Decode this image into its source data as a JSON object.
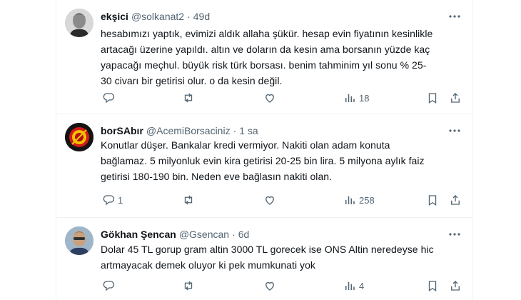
{
  "tweets": [
    {
      "name": "ekşici",
      "handle": "@solkanat2",
      "time": "49d",
      "lines": [
        "hesabımızı yaptık, evimizi aldık allaha şükür. hesap evin fiyatının kesinlikle",
        "artacağı üzerine yapıldı. altın ve doların da kesin ama borsanın yüzde kaç",
        "yapacağı meçhul. büyük risk türk borsası. benim tahminim yıl sonu % 25-",
        "30 civarı bir getirisi olur. o da kesin değil."
      ],
      "replies": "",
      "views": "18"
    },
    {
      "name": "borSAbır",
      "handle": "@AcemiBorsaciniz",
      "time": "1 sa",
      "lines": [
        "Konutlar düşer. Bankalar kredi vermiyor. Nakiti olan adam konuta",
        "bağlamaz. 5 milyonluk evin kira getirisi 20-25 bin lira. 5 milyona aylık faiz",
        "getirisi 180-190 bin. Neden eve bağlasın nakiti olan."
      ],
      "replies": "1",
      "views": "258"
    },
    {
      "name": "Gökhan Şencan",
      "handle": "@Gsencan",
      "time": "6d",
      "lines": [
        "Dolar 45 TL gorup gram altin 3000 TL gorecek ise ONS Altin neredeyse hic",
        "artmayacak demek oluyor ki pek mumkunati yok"
      ],
      "replies": "",
      "views": "4"
    }
  ],
  "icons": {
    "more": "more-icon",
    "reply": "reply-icon",
    "retweet": "retweet-icon",
    "like": "like-icon",
    "views": "views-icon",
    "bookmark": "bookmark-icon",
    "share": "share-icon"
  },
  "colors": {
    "text": "#0f1419",
    "secondary": "#536471",
    "divider": "#eff3f4"
  }
}
